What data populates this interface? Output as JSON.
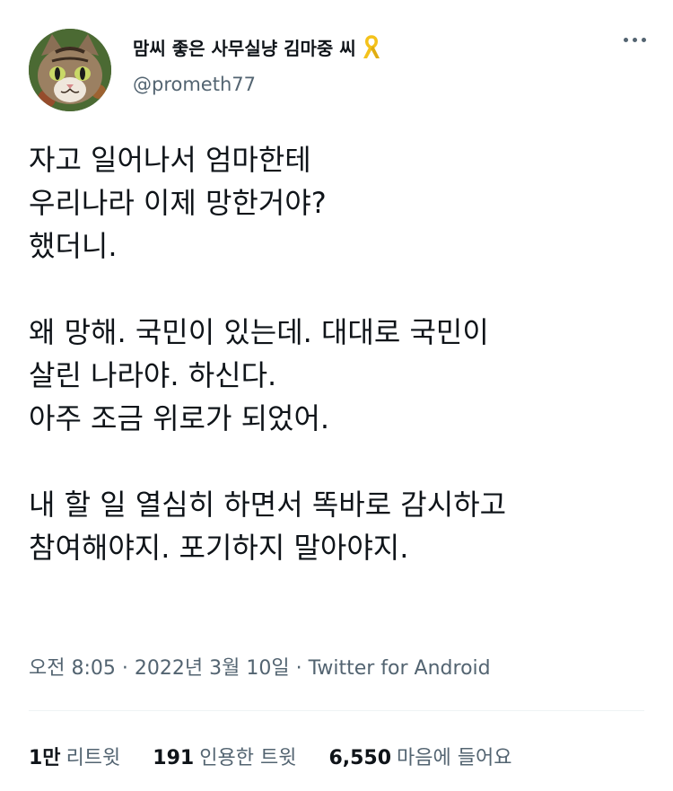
{
  "author": {
    "display_name": "맘씨 좋은 사무실냥 김마중 씨",
    "handle": "@prometh77",
    "avatar_icon": "cat-avatar-icon",
    "badge_icon": "yellow-ribbon-icon"
  },
  "menu_icon": "more-options-icon",
  "tweet": {
    "paragraphs": [
      "자고 일어나서 엄마한테\n우리나라 이제 망한거야?\n했더니.",
      "왜 망해. 국민이 있는데. 대대로 국민이\n살린 나라야. 하신다.\n아주 조금 위로가 되었어.",
      "내 할 일 열심히 하면서 똑바로 감시하고\n참여해야지. 포기하지 말아야지."
    ]
  },
  "meta": {
    "time": "오전 8:05",
    "separator": "·",
    "date": "2022년 3월 10일",
    "source": "Twitter for Android"
  },
  "stats": {
    "retweets": {
      "count": "1만",
      "label": "리트윗"
    },
    "quotes": {
      "count": "191",
      "label": "인용한 트윗"
    },
    "likes": {
      "count": "6,550",
      "label": "마음에 들어요"
    }
  },
  "colors": {
    "text": "#0f1419",
    "secondary": "#536471",
    "divider": "#eff3f4",
    "ribbon": "#f4c21b"
  }
}
